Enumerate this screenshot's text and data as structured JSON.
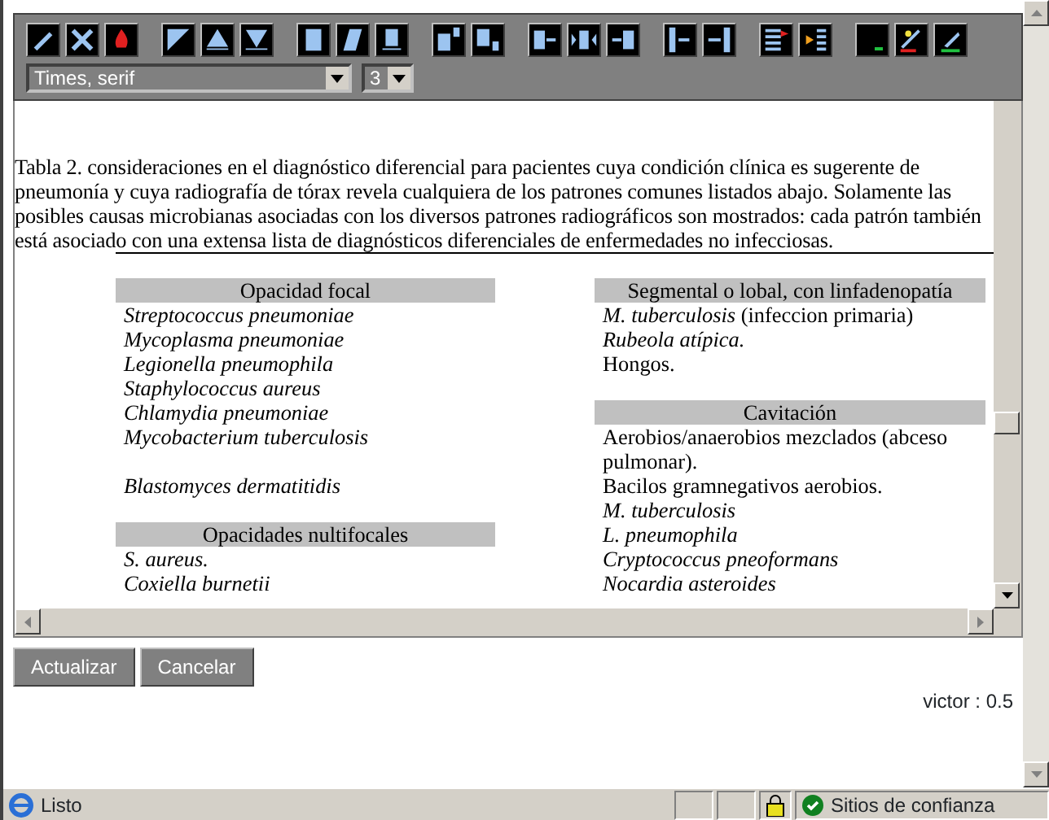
{
  "toolbar": {
    "font_select": "Times, serif",
    "size_select": "3"
  },
  "caption": "Tabla 2. consideraciones en el diagnóstico diferencial para pacientes cuya condición clínica es sugerente de pneumonía y cuya radiografía de tórax revela cualquiera de los patrones comunes listados abajo. Solamente las posibles causas microbianas asociadas con los diversos patrones radiográficos son mostrados: cada patrón también está asociado con una extensa lista de diagnósticos diferenciales de enfermedades no infecciosas.",
  "columns": [
    {
      "sections": [
        {
          "heading": "Opacidad focal",
          "items": [
            {
              "text": "Streptococcus pneumoniae",
              "italic": true,
              "gap_before": false
            },
            {
              "text": "Mycoplasma pneumoniae",
              "italic": true,
              "gap_before": false
            },
            {
              "text": "Legionella pneumophila",
              "italic": true,
              "gap_before": false
            },
            {
              "text": "Staphylococcus aureus",
              "italic": true,
              "gap_before": false
            },
            {
              "text": "Chlamydia pneumoniae",
              "italic": true,
              "gap_before": false
            },
            {
              "text": "Mycobacterium tuberculosis",
              "italic": true,
              "gap_before": false
            },
            {
              "text": "Blastomyces dermatitidis",
              "italic": true,
              "gap_before": true
            }
          ]
        },
        {
          "heading": "Opacidades nultifocales",
          "items": [
            {
              "text": "S. aureus.",
              "italic": true,
              "gap_before": false
            },
            {
              "text": "Coxiella burnetii",
              "italic": true,
              "gap_before": false
            }
          ]
        }
      ]
    },
    {
      "sections": [
        {
          "heading": "Segmental o lobal, con linfadenopatía",
          "items": [
            {
              "text": "*M. tuberculosis* (infeccion primaria)",
              "italic": false,
              "gap_before": false
            },
            {
              "text": "Rubeola atípica.",
              "italic": true,
              "gap_before": false
            },
            {
              "text": "Hongos.",
              "italic": false,
              "gap_before": false
            }
          ]
        },
        {
          "heading": "Cavitación",
          "items": [
            {
              "text": "Aerobios/anaerobios mezclados (abceso pulmonar).",
              "italic": false,
              "gap_before": false
            },
            {
              "text": "Bacilos gramnegativos aerobios.",
              "italic": false,
              "gap_before": false
            },
            {
              "text": "M. tuberculosis",
              "italic": true,
              "gap_before": false
            },
            {
              "text": "L. pneumophila",
              "italic": true,
              "gap_before": false
            },
            {
              "text": "Cryptococcus pneoformans",
              "italic": true,
              "gap_before": false
            },
            {
              "text": "Nocardia asteroides",
              "italic": true,
              "gap_before": false
            }
          ]
        }
      ]
    }
  ],
  "buttons": [
    "Actualizar",
    "Cancelar"
  ],
  "version": "victor : 0.5",
  "status_bar": {
    "text": "Listo",
    "zone": "Sitios de confianza"
  }
}
